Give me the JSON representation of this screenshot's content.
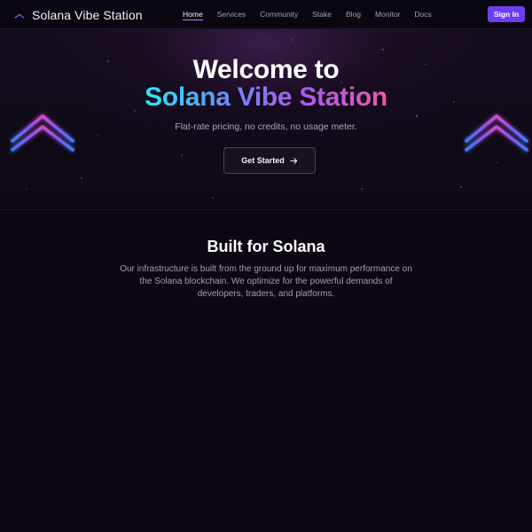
{
  "nav": {
    "brand": "Solana Vibe Station",
    "links": [
      {
        "label": "Home",
        "active": true
      },
      {
        "label": "Services",
        "active": false
      },
      {
        "label": "Community",
        "active": false
      },
      {
        "label": "Stake",
        "active": false
      },
      {
        "label": "Blog",
        "active": false
      },
      {
        "label": "Monitor",
        "active": false
      },
      {
        "label": "Docs",
        "active": false
      }
    ],
    "signin_label": "Sign In"
  },
  "hero": {
    "title_line1": "Welcome to",
    "title_line2": "Solana Vibe Station",
    "subtitle": "Flat-rate pricing, no credits, no usage meter.",
    "cta_label": "Get Started",
    "cta_icon": "arrow-right-icon",
    "decoration_icon": "tower-icon"
  },
  "section": {
    "title": "Built for Solana",
    "body": "Our infrastructure is built from the ground up for maximum performance on the Solana blockchain. We optimize for the powerful demands of developers, traders, and platforms."
  },
  "colors": {
    "background": "#0c0712",
    "accent": "#6d3ef0",
    "gradient_start": "#2ee6f5",
    "gradient_end": "#e85aa8"
  }
}
